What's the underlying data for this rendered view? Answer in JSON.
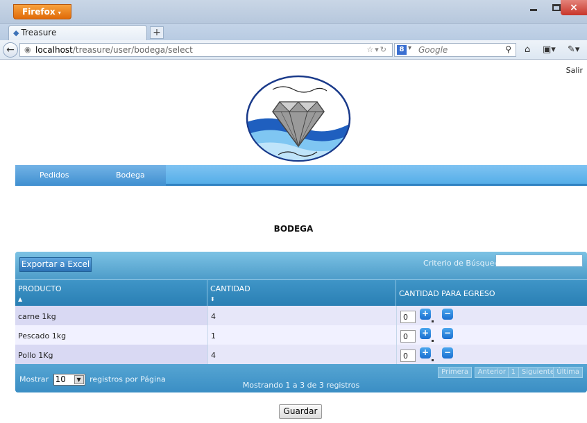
{
  "browser": {
    "menu_button": "Firefox",
    "tab_title": "Treasure",
    "new_tab": "+",
    "url_host": "localhost",
    "url_path": "/treasure/user/bodega/select",
    "search_engine": "8",
    "search_placeholder": "Google",
    "close_glyph": "×"
  },
  "header": {
    "salir": "Salir"
  },
  "menu": {
    "items": [
      {
        "label": "Pedidos"
      },
      {
        "label": "Bodega"
      }
    ]
  },
  "page": {
    "heading": "BODEGA"
  },
  "grid": {
    "export_label": "Exportar a Excel",
    "search_label": "Criterio de Búsqueda:",
    "search_value": "",
    "columns": [
      "PRODUCTO",
      "CANTIDAD",
      "CANTIDAD PARA EGRESO"
    ],
    "rows": [
      {
        "producto": "carne 1kg",
        "cantidad": "4",
        "egreso": "0"
      },
      {
        "producto": "Pescado 1kg",
        "cantidad": "1",
        "egreso": "0"
      },
      {
        "producto": "Pollo 1Kg",
        "cantidad": "4",
        "egreso": "0"
      }
    ],
    "footer": {
      "show_prefix": "Mostrar",
      "page_size": "10",
      "show_suffix": "registros por Página",
      "info": "Mostrando 1 a 3 de 3 registros",
      "pager": [
        "Primera",
        "Anterior",
        "1",
        "Siguiente",
        "Última"
      ]
    }
  },
  "actions": {
    "save_label": "Guardar"
  },
  "colors": {
    "menu_blue": "#55aee8",
    "grid_header": "#2a7fb4",
    "row_even": "#e7e7f9",
    "row_odd": "#f1f1ff",
    "firefox_orange": "#e06a08"
  }
}
